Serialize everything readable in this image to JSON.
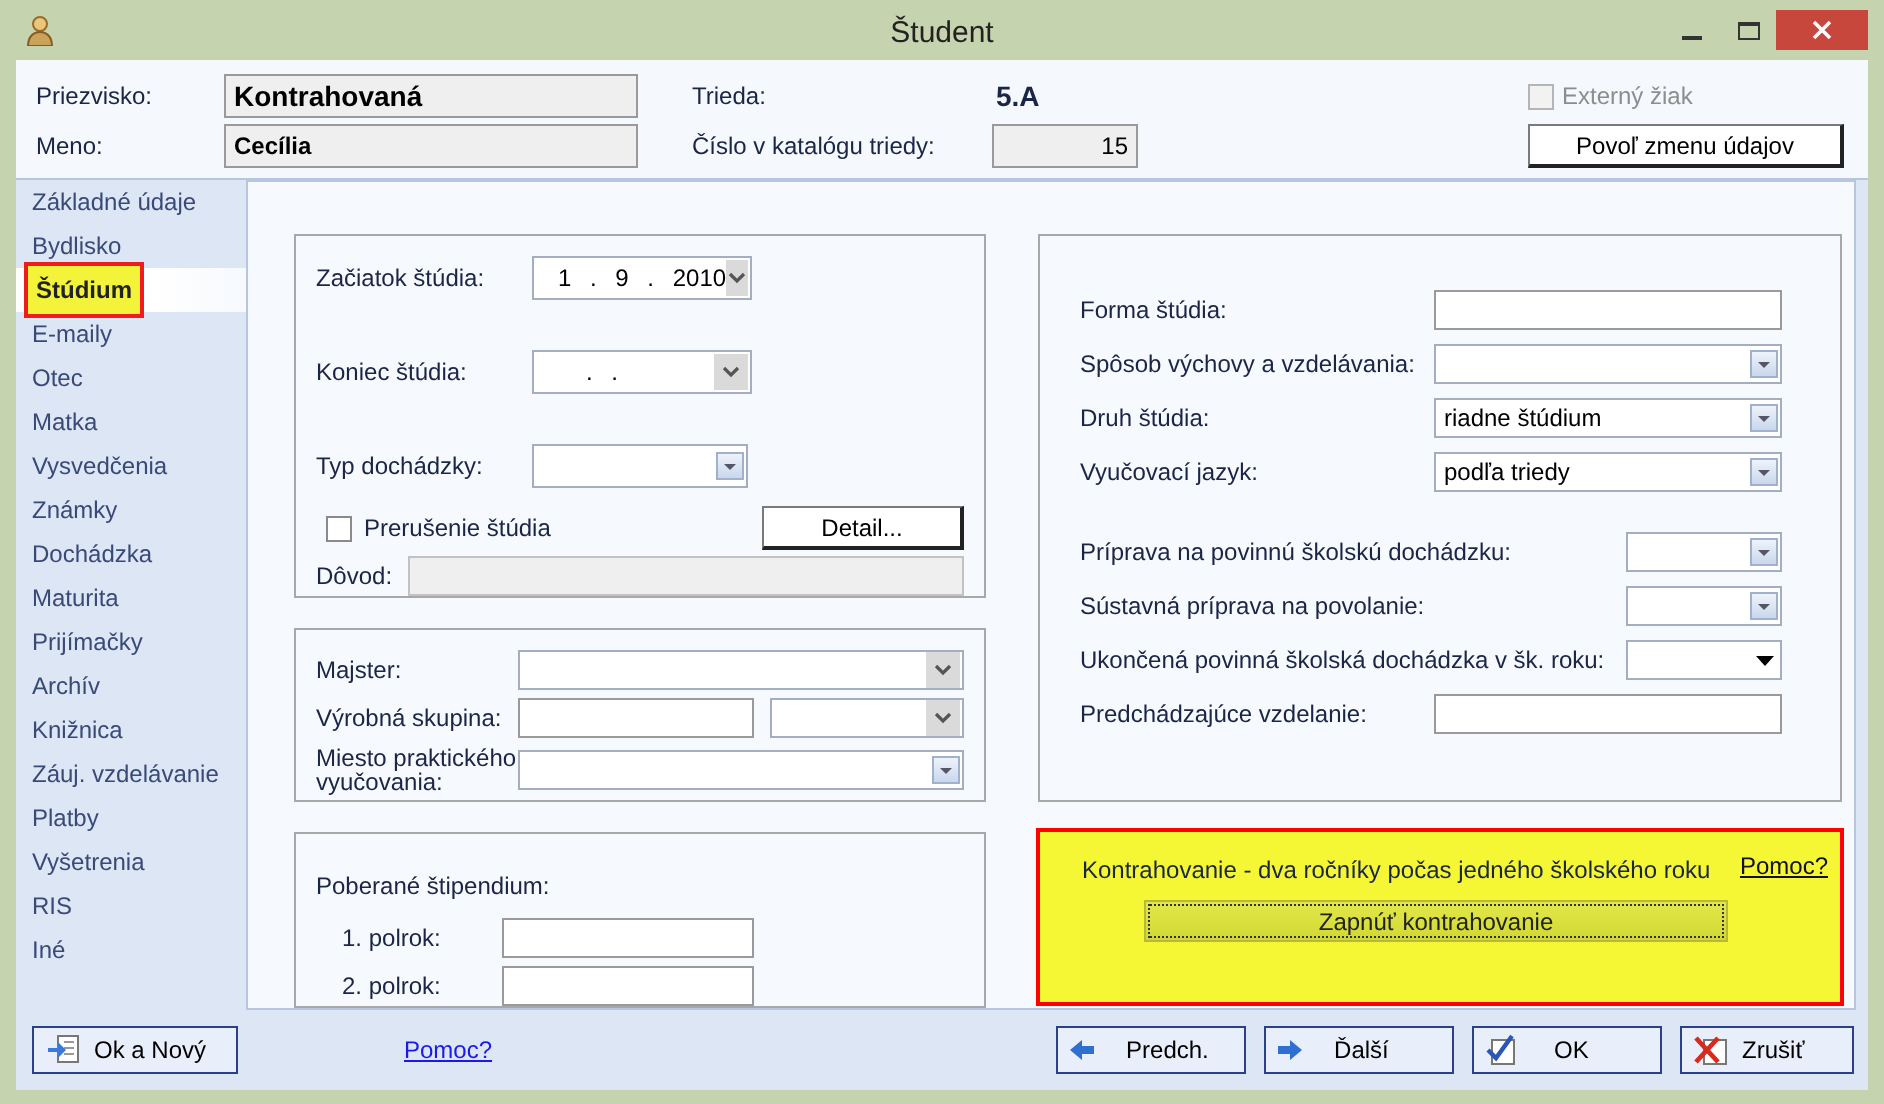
{
  "window": {
    "title": "Študent"
  },
  "student": {
    "surname_label": "Priezvisko:",
    "surname": "Kontrahovaná",
    "first_name_label": "Meno:",
    "first_name": "Cecília",
    "class_label": "Trieda:",
    "class": "5.A",
    "catalog_label": "Číslo v katalógu triedy:",
    "catalog_number": "15",
    "external": {
      "label": "Externý žiak",
      "checked": false,
      "disabled": true
    },
    "unlock_button": "Povoľ zmenu údajov"
  },
  "sidebar": {
    "items": [
      {
        "label": "Základné údaje",
        "selected": false
      },
      {
        "label": "Bydlisko",
        "selected": false
      },
      {
        "label": "Štúdium",
        "selected": true
      },
      {
        "label": "E-maily",
        "selected": false
      },
      {
        "label": "Otec",
        "selected": false
      },
      {
        "label": "Matka",
        "selected": false
      },
      {
        "label": "Vysvedčenia",
        "selected": false
      },
      {
        "label": "Známky",
        "selected": false
      },
      {
        "label": "Dochádzka",
        "selected": false
      },
      {
        "label": "Maturita",
        "selected": false
      },
      {
        "label": "Prijímačky",
        "selected": false
      },
      {
        "label": "Archív",
        "selected": false
      },
      {
        "label": "Knižnica",
        "selected": false
      },
      {
        "label": "Záuj. vzdelávanie",
        "selected": false
      },
      {
        "label": "Platby",
        "selected": false
      },
      {
        "label": "Vyšetrenia",
        "selected": false
      },
      {
        "label": "RIS",
        "selected": false
      },
      {
        "label": "Iné",
        "selected": false
      }
    ]
  },
  "study": {
    "rows": [
      {
        "kind": "date",
        "label": "Začiatok štúdia:",
        "value": "1 . 9 . 2010"
      },
      {
        "kind": "date",
        "label": "Koniec štúdia:",
        "value": ". ."
      },
      {
        "kind": "combo",
        "label": "Typ dochádzky:"
      }
    ],
    "interruption": {
      "label": "Prerušenie štúdia",
      "checked": false
    },
    "detail_button": "Detail...",
    "reason": {
      "label": "Dôvod:",
      "disabled": true
    }
  },
  "practice": {
    "rows": [
      {
        "kind": "select",
        "label": "Majster:"
      },
      {
        "kind": "pair",
        "label": "Výrobná skupina:"
      },
      {
        "kind": "combo",
        "label": "Miesto praktického vyučovania:"
      }
    ]
  },
  "scholarship": {
    "title": "Poberané štipendium:",
    "rows": [
      {
        "kind": "text",
        "label": "1. polrok:"
      },
      {
        "kind": "text",
        "label": "2. polrok:"
      }
    ]
  },
  "study_form": {
    "sections": [
      [
        {
          "kind": "text",
          "label": "Forma štúdia:"
        },
        {
          "kind": "combo",
          "label": "Spôsob výchovy a vzdelávania:"
        },
        {
          "kind": "combo",
          "label": "Druh štúdia:",
          "value": "riadne štúdium"
        },
        {
          "kind": "combo",
          "label": "Vyučovací jazyk:",
          "value": "podľa triedy"
        }
      ],
      [
        {
          "kind": "combo",
          "label": "Príprava na povinnú školskú dochádzku:"
        },
        {
          "kind": "combo",
          "label": "Sústavná príprava na povolanie:"
        },
        {
          "kind": "picker",
          "label": "Ukončená povinná školská dochádzka v šk. roku:"
        },
        {
          "kind": "text",
          "label": "Predchádzajúce vzdelanie:"
        }
      ]
    ]
  },
  "contraction": {
    "text": "Kontrahovanie - dva ročníky počas jedného školského roku",
    "help_link": "Pomoc?",
    "button": "Zapnúť kontrahovanie"
  },
  "footer": {
    "help_link": "Pomoc?",
    "buttons": [
      {
        "kind": "new",
        "label": "Ok a Nový"
      },
      {
        "kind": "prev",
        "label": "Predch."
      },
      {
        "kind": "next",
        "label": "Ďalší"
      },
      {
        "kind": "ok",
        "label": "OK"
      },
      {
        "kind": "cancel",
        "label": "Zrušiť"
      }
    ]
  }
}
